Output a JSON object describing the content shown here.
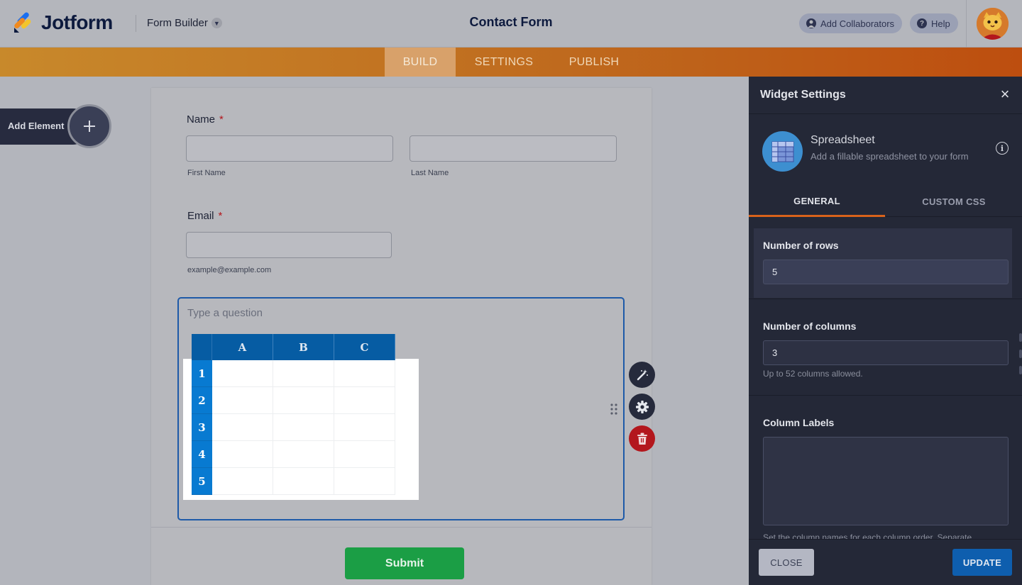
{
  "header": {
    "logo_text": "Jotform",
    "builder_menu": "Form Builder",
    "form_title": "Contact Form",
    "add_collaborators": "Add Collaborators",
    "help": "Help"
  },
  "nav": {
    "tabs": [
      {
        "label": "BUILD",
        "active": true
      },
      {
        "label": "SETTINGS",
        "active": false
      },
      {
        "label": "PUBLISH",
        "active": false
      }
    ]
  },
  "sidebar": {
    "add_element": "Add Element"
  },
  "form": {
    "name_label": "Name",
    "required_mark": "*",
    "first_name_sub": "First Name",
    "last_name_sub": "Last Name",
    "email_label": "Email",
    "email_sub": "example@example.com",
    "question_placeholder": "Type a question",
    "submit_label": "Submit"
  },
  "spreadsheet": {
    "columns": [
      "A",
      "B",
      "C"
    ],
    "rows": [
      "1",
      "2",
      "3",
      "4",
      "5"
    ]
  },
  "panel": {
    "title": "Widget Settings",
    "close_icon": "×",
    "widget_name": "Spreadsheet",
    "widget_desc": "Add a fillable spreadsheet to your form",
    "info_icon": "i",
    "tab_general": "GENERAL",
    "tab_css": "CUSTOM CSS",
    "rows_label": "Number of rows",
    "rows_value": "5",
    "cols_label": "Number of columns",
    "cols_value": "3",
    "cols_hint": "Up to 52 columns allowed.",
    "labels_label": "Column Labels",
    "labels_hint": "Set the column names for each column order. Separate",
    "close_btn": "CLOSE",
    "update_btn": "UPDATE"
  },
  "colors": {
    "nav_gradient_start": "#c8892b",
    "nav_gradient_end": "#bd4e0f",
    "submit_green": "#1b9e45",
    "sheet_header_blue": "#065ca3",
    "sheet_rownum_blue": "#087ad1",
    "update_blue": "#0e5eae",
    "delete_red": "#b3171d",
    "active_tab_orange": "#d8621b"
  }
}
